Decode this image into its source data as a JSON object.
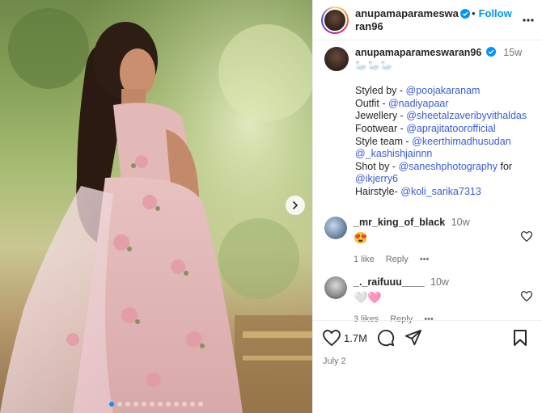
{
  "post": {
    "author": "anupamaparameswaran96",
    "follow_dot": "•",
    "follow_label": "Follow",
    "media": {
      "slide_count": 12,
      "active_slide": 1
    },
    "caption": {
      "username": "anupamaparameswaran96",
      "time": "15w",
      "emoji_line": "🦢🦢🦢",
      "credits": [
        {
          "label": "Styled by - ",
          "handles": [
            "@poojakaranam"
          ]
        },
        {
          "label": "Outfit - ",
          "handles": [
            "@nadiyapaar"
          ]
        },
        {
          "label": "Jewellery - ",
          "handles": [
            "@sheetalzaveribyvithaldas"
          ]
        },
        {
          "label": "Footwear - ",
          "handles": [
            "@aprajitatoorofficial"
          ]
        },
        {
          "label": "Style team - ",
          "handles": [
            "@keerthimadhusudan",
            "@_kashishjainnn"
          ]
        },
        {
          "label": "Shot by - ",
          "handles": [
            "@saneshphotography"
          ],
          "suffix": " for",
          "tail": "@ikjerry6"
        },
        {
          "label": "Hairstyle- ",
          "handles": [
            "@koli_sarika7313"
          ]
        }
      ]
    },
    "comments": [
      {
        "username": "_mr_king_of_black",
        "time": "10w",
        "text": "😍",
        "likes": "1 like",
        "reply": "Reply",
        "more": "•••"
      },
      {
        "username": "_._raifuuu____",
        "time": "10w",
        "text": "🤍🩷",
        "likes": "3 likes",
        "reply": "Reply",
        "more": "•••"
      }
    ],
    "like_count": "1.7M",
    "date": "July 2"
  },
  "colors": {
    "accent": "#0095f6",
    "link": "#3b5bd8",
    "muted": "#737373"
  }
}
